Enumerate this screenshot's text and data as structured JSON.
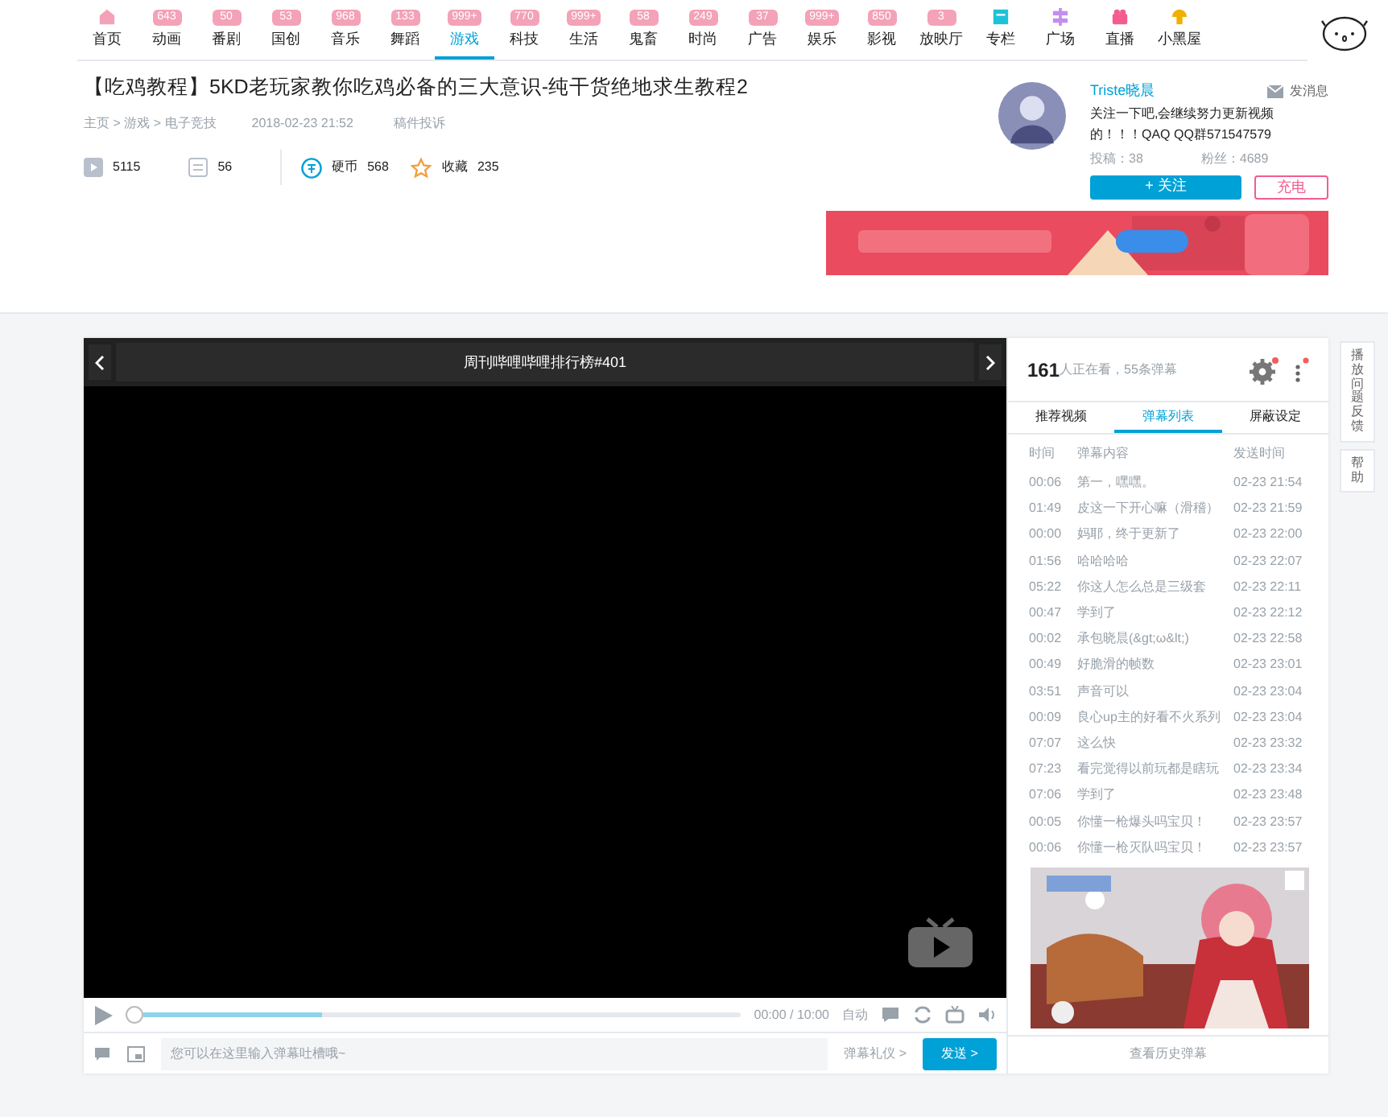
{
  "nav": {
    "items": [
      {
        "kind": "icon",
        "label": "首页",
        "selected": false
      },
      {
        "kind": "count",
        "count": "643",
        "label": "动画",
        "selected": false
      },
      {
        "kind": "count",
        "count": "50",
        "label": "番剧",
        "selected": false
      },
      {
        "kind": "count",
        "count": "53",
        "label": "国创",
        "selected": false
      },
      {
        "kind": "count",
        "count": "968",
        "label": "音乐",
        "selected": false
      },
      {
        "kind": "count",
        "count": "133",
        "label": "舞蹈",
        "selected": false
      },
      {
        "kind": "count",
        "count": "999+",
        "label": "游戏",
        "selected": true
      },
      {
        "kind": "count",
        "count": "770",
        "label": "科技",
        "selected": false
      },
      {
        "kind": "count",
        "count": "999+",
        "label": "生活",
        "selected": false
      },
      {
        "kind": "count",
        "count": "58",
        "label": "鬼畜",
        "selected": false
      },
      {
        "kind": "count",
        "count": "249",
        "label": "时尚",
        "selected": false
      },
      {
        "kind": "count",
        "count": "37",
        "label": "广告",
        "selected": false
      },
      {
        "kind": "count",
        "count": "999+",
        "label": "娱乐",
        "selected": false
      },
      {
        "kind": "count",
        "count": "850",
        "label": "影视",
        "selected": false
      },
      {
        "kind": "count",
        "count": "3",
        "label": "放映厅",
        "selected": false
      },
      {
        "kind": "icon",
        "label": "专栏",
        "selected": false
      },
      {
        "kind": "icon",
        "label": "广场",
        "selected": false
      },
      {
        "kind": "icon",
        "label": "直播",
        "selected": false
      },
      {
        "kind": "icon",
        "label": "小黑屋",
        "selected": false
      }
    ]
  },
  "video": {
    "title": "【吃鸡教程】5KD老玩家教你吃鸡必备的三大意识-纯干货绝地求生教程2",
    "breadcrumb": [
      "主页",
      "游戏",
      "电子竞技"
    ],
    "separator": ">",
    "date": "2018-02-23 21:52",
    "report": "稿件投诉",
    "plays": "5115",
    "danmaku": "56",
    "coin_label": "硬币",
    "coins": "568",
    "fav_label": "收藏",
    "favorites": "235"
  },
  "uploader": {
    "name": "Triste晓晨",
    "message": "发消息",
    "bio": "关注一下吧,会继续努力更新视频的！！！QAQ QQ群571547579",
    "uploads": "投稿：38",
    "fans": "粉丝：4689",
    "follow": "+ 关注",
    "charge": "充电"
  },
  "player": {
    "title": "周刊哔哩哔哩排行榜#401",
    "buffer": {
      "level": 0.3
    },
    "time": "00:00 / 10:00",
    "quality": "自动",
    "placeholder": "您可以在这里输入弹幕吐槽哦~",
    "etiquette": "弹幕礼仪 >",
    "send": "发送 >"
  },
  "danmaku_panel": {
    "watching": "161",
    "watching_text": "人正在看，55条弹幕",
    "tabs": [
      {
        "label": "推荐视频",
        "selected": false
      },
      {
        "label": "弹幕列表",
        "selected": true
      },
      {
        "label": "屏蔽设定",
        "selected": false
      }
    ],
    "columns": [
      "时间",
      "弹幕内容",
      "发送时间"
    ],
    "rows": [
      [
        "00:06",
        "第一，嘿嘿。",
        "02-23 21:54"
      ],
      [
        "01:49",
        "皮这一下开心嘛（滑稽）",
        "02-23 21:59"
      ],
      [
        "00:00",
        "妈耶，终于更新了",
        "02-23 22:00"
      ],
      [
        "01:56",
        "哈哈哈哈",
        "02-23 22:07"
      ],
      [
        "05:22",
        "你这人怎么总是三级套",
        "02-23 22:11"
      ],
      [
        "00:47",
        "学到了",
        "02-23 22:12"
      ],
      [
        "00:02",
        "承包晓晨(&gt;ω&lt;)",
        "02-23 22:58"
      ],
      [
        "00:49",
        "好脆滑的帧数",
        "02-23 23:01"
      ],
      [
        "03:51",
        "声音可以",
        "02-23 23:04"
      ],
      [
        "00:09",
        "良心up主的好看不火系列",
        "02-23 23:04"
      ],
      [
        "07:07",
        "这么快",
        "02-23 23:32"
      ],
      [
        "07:23",
        "看完觉得以前玩都是瞎玩",
        "02-23 23:34"
      ],
      [
        "07:06",
        "学到了",
        "02-23 23:48"
      ],
      [
        "00:05",
        "你懂一枪爆头吗宝贝！",
        "02-23 23:57"
      ],
      [
        "00:06",
        "你懂一枪灭队吗宝贝！",
        "02-23 23:57"
      ]
    ],
    "history": "查看历史弹幕"
  },
  "side_buttons": [
    "播放问题反馈",
    "帮助"
  ]
}
